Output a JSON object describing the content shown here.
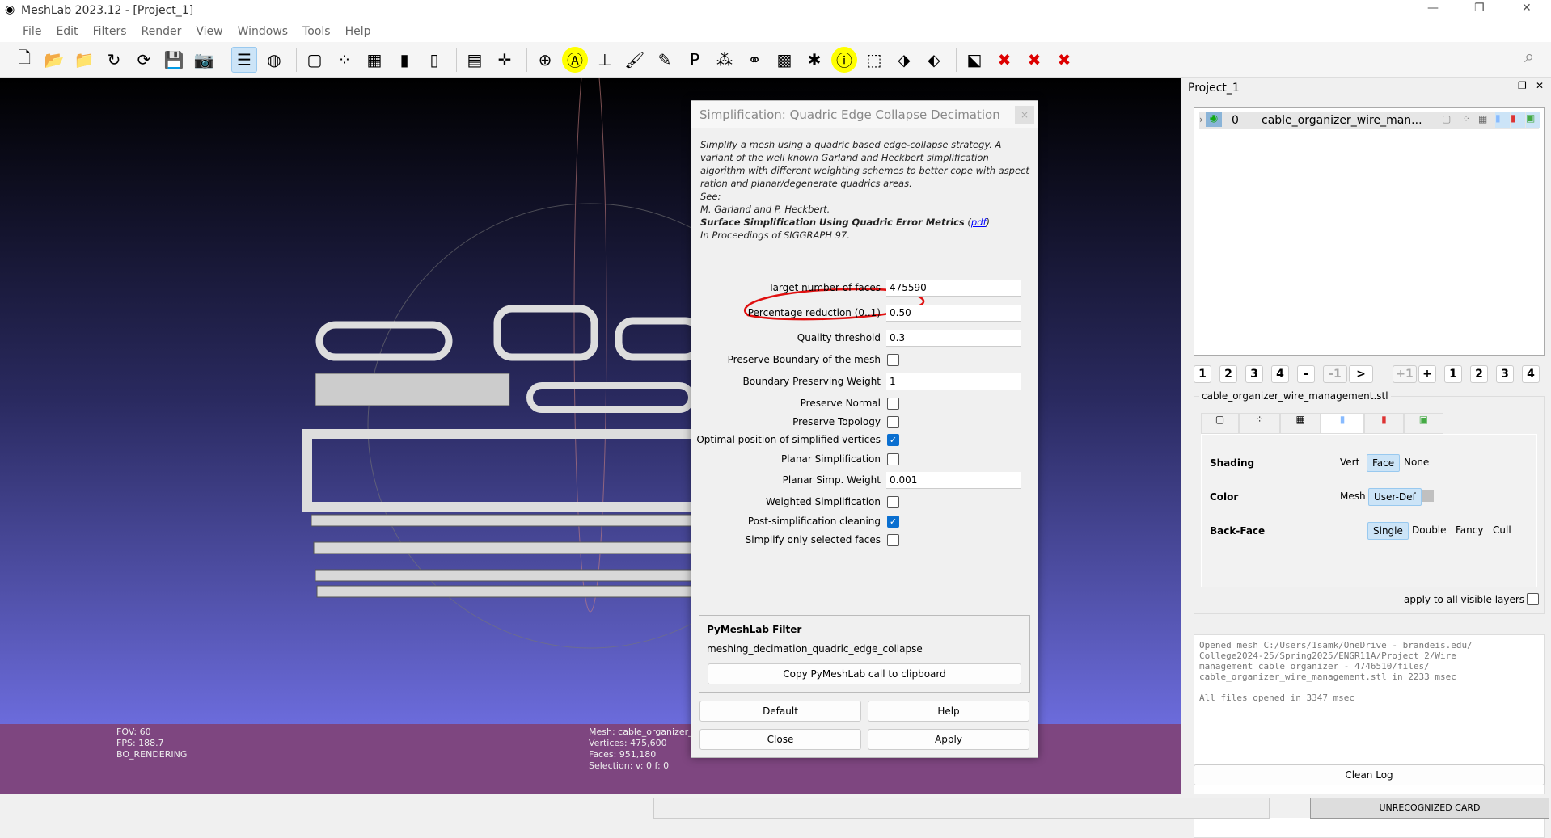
{
  "window": {
    "title": "MeshLab 2023.12 - [Project_1]"
  },
  "menu": [
    "File",
    "Edit",
    "Filters",
    "Render",
    "View",
    "Windows",
    "Tools",
    "Help"
  ],
  "toolbar": {
    "icons": [
      "new-project",
      "open-project",
      "import-mesh",
      "reload",
      "reload-all",
      "save",
      "snapshot",
      "layers",
      "ortho-view",
      "bbox",
      "points",
      "wireframe",
      "flat",
      "smooth",
      "layers-stack",
      "axis",
      "trackball",
      "annotation",
      "measure",
      "paint",
      "pick-points",
      "pp-plugin",
      "align",
      "mutual-info",
      "raster",
      "georef",
      "info",
      "select-faces",
      "select-vertices",
      "select-connected",
      "select-plane",
      "delete-1",
      "delete-2",
      "delete-3"
    ],
    "search_icon": "search"
  },
  "viewport": {
    "info_left": [
      "FOV: 60",
      "FPS:   188.7",
      "BO_RENDERING"
    ],
    "info_right": [
      "Mesh: cable_organizer_",
      "Vertices: 475,600",
      "Faces: 951,180",
      "Selection: v: 0 f: 0"
    ],
    "mesh_color": "#d8d8d8"
  },
  "dialog": {
    "title": "Simplification: Quadric Edge Collapse Decimation",
    "close": "×",
    "desc_lines": [
      "Simplify a mesh using a quadric based edge-collapse strategy. A variant of the well known Garland and Heckbert simplification algorithm with different weighting schemes to better cope with aspect ration and planar/degenerate quadrics areas.",
      "See:",
      "M. Garland and P. Heckbert."
    ],
    "ref_title": "Surface Simplification Using Quadric Error Metrics",
    "ref_link": "pdf",
    "ref_venue": "In Proceedings of SIGGRAPH 97.",
    "params": [
      {
        "label": "Target number of faces",
        "value": "475590"
      },
      {
        "label": "Percentage reduction (0..1)",
        "value": "0.50"
      },
      {
        "label": "Quality threshold",
        "value": "0.3"
      },
      {
        "label": "Preserve Boundary of the mesh",
        "checked": false
      },
      {
        "label": "Boundary Preserving Weight",
        "value": "1"
      },
      {
        "label": "Preserve Normal",
        "checked": false
      },
      {
        "label": "Preserve Topology",
        "checked": false
      },
      {
        "label": "Optimal position of simplified vertices",
        "checked": true
      },
      {
        "label": "Planar Simplification",
        "checked": false
      },
      {
        "label": "Planar Simp. Weight",
        "value": "0.001"
      },
      {
        "label": "Weighted Simplification",
        "checked": false
      },
      {
        "label": "Post-simplification cleaning",
        "checked": true
      },
      {
        "label": "Simplify only selected faces",
        "checked": false
      }
    ],
    "pymeshlab": {
      "heading": "PyMeshLab Filter",
      "name": "meshing_decimation_quadric_edge_collapse",
      "copy": "Copy PyMeshLab call to clipboard"
    },
    "buttons": {
      "default": "Default",
      "help": "Help",
      "close": "Close",
      "apply": "Apply"
    },
    "annotation_color": "#e01010"
  },
  "panel": {
    "title": "Project_1",
    "layer": {
      "index": "0",
      "name": "cable_organizer_wire_man..."
    },
    "nav": [
      "1",
      "2",
      "3",
      "4",
      "-",
      "-1",
      ">",
      "+1",
      "+",
      "1",
      "2",
      "3",
      "4"
    ],
    "mesh_file": "cable_organizer_wire_management.stl",
    "shading": {
      "label": "Shading",
      "options": [
        "Vert",
        "Face",
        "None"
      ],
      "selected": "Face"
    },
    "color": {
      "label": "Color",
      "options": [
        "Mesh",
        "User-Def"
      ],
      "selected": "User-Def",
      "swatch": "#c0c0c0"
    },
    "backface": {
      "label": "Back-Face",
      "options": [
        "Single",
        "Double",
        "Fancy",
        "Cull"
      ],
      "selected": "Single"
    },
    "apply_all": "apply to all visible layers",
    "log": "Opened mesh C:/Users/1samk/OneDrive - brandeis.edu/\nCollege2024-25/Spring2025/ENGR11A/Project 2/Wire\nmanagement cable organizer - 4746510/files/\ncable_organizer_wire_management.stl in 2233 msec\n\nAll files opened in 3347 msec",
    "clean_log": "Clean Log"
  },
  "status": {
    "card": "UNRECOGNIZED CARD"
  }
}
